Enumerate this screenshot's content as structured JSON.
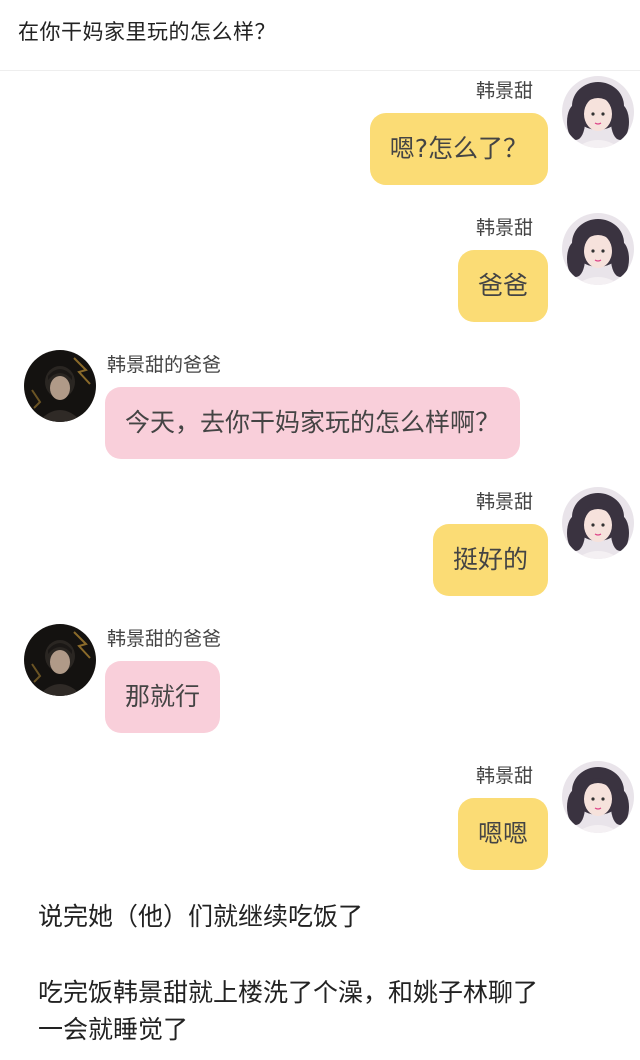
{
  "header": {
    "title": "在你干妈家里玩的怎么样？"
  },
  "messages": [
    {
      "side": "right",
      "sender": "韩景甜",
      "text": "嗯?怎么了？",
      "avatar": "girl-avatar-icon"
    },
    {
      "side": "right",
      "sender": "韩景甜",
      "text": "爸爸",
      "avatar": "girl-avatar-icon"
    },
    {
      "side": "left",
      "sender": "韩景甜的爸爸",
      "text": "今天，去你干妈家玩的怎么样啊？",
      "avatar": "boy-avatar-icon"
    },
    {
      "side": "right",
      "sender": "韩景甜",
      "text": "挺好的",
      "avatar": "girl-avatar-icon"
    },
    {
      "side": "left",
      "sender": "韩景甜的爸爸",
      "text": "那就行",
      "avatar": "boy-avatar-icon"
    },
    {
      "side": "right",
      "sender": "韩景甜",
      "text": "嗯嗯",
      "avatar": "girl-avatar-icon"
    }
  ],
  "narration": {
    "line1": "说完她（他）们就继续吃饭了",
    "line2": "吃完饭韩景甜就上楼洗了个澡，和姚子林聊了",
    "line3": "一会就睡觉了"
  },
  "colors": {
    "right_bubble": "#fbdc75",
    "left_bubble": "#f9cfda"
  }
}
